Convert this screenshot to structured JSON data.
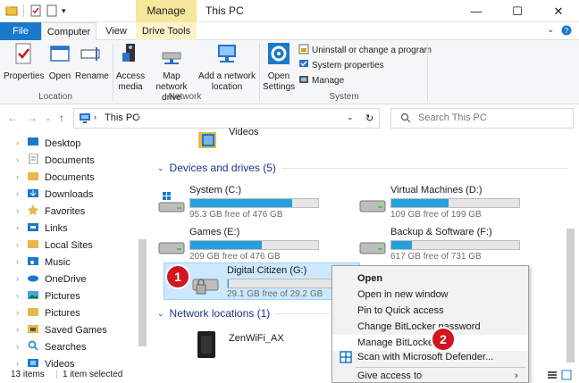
{
  "window": {
    "title": "This PC",
    "context_tab": "Manage",
    "minimize": "—",
    "maximize": "☐",
    "close": "✕"
  },
  "ribbon_tabs": {
    "file": "File",
    "computer": "Computer",
    "view": "View",
    "drive_tools": "Drive Tools"
  },
  "ribbon": {
    "location": {
      "label": "Location",
      "properties": "Properties",
      "open": "Open",
      "rename": "Rename"
    },
    "network": {
      "label": "Network",
      "access_media": "Access media",
      "map_network_drive": "Map network drive",
      "add_network_location": "Add a network location"
    },
    "system": {
      "label": "System",
      "open_settings": "Open Settings",
      "uninstall": "Uninstall or change a program",
      "system_properties": "System properties",
      "manage": "Manage"
    }
  },
  "address": {
    "path": "This PC",
    "search_placeholder": "Search This PC"
  },
  "nav_items": [
    {
      "label": "Desktop",
      "icon": "desktop-icon"
    },
    {
      "label": "Documents",
      "icon": "documents-icon"
    },
    {
      "label": "Documents",
      "icon": "folder-icon"
    },
    {
      "label": "Downloads",
      "icon": "downloads-icon"
    },
    {
      "label": "Favorites",
      "icon": "favorites-icon"
    },
    {
      "label": "Links",
      "icon": "links-icon"
    },
    {
      "label": "Local Sites",
      "icon": "folder-icon"
    },
    {
      "label": "Music",
      "icon": "music-icon"
    },
    {
      "label": "OneDrive",
      "icon": "onedrive-icon"
    },
    {
      "label": "Pictures",
      "icon": "pictures-icon"
    },
    {
      "label": "Pictures",
      "icon": "folder-icon"
    },
    {
      "label": "Saved Games",
      "icon": "saved-games-icon"
    },
    {
      "label": "Searches",
      "icon": "searches-icon"
    },
    {
      "label": "Videos",
      "icon": "videos-icon"
    }
  ],
  "content": {
    "videos_label": "Videos",
    "devices_header": "Devices and drives (5)",
    "network_header": "Network locations (1)",
    "drives": [
      {
        "name": "System (C:)",
        "free": "95.3 GB free of 476 GB",
        "used_fraction": 0.8
      },
      {
        "name": "Virtual Machines (D:)",
        "free": "109 GB free of 199 GB",
        "used_fraction": 0.45
      },
      {
        "name": "Games (E:)",
        "free": "209 GB free of 476 GB",
        "used_fraction": 0.56
      },
      {
        "name": "Backup & Software (F:)",
        "free": "617 GB free of 731 GB",
        "used_fraction": 0.16
      },
      {
        "name": "Digital Citizen (G:)",
        "free": "29.1 GB free of 29.2 GB",
        "used_fraction": 0.01
      }
    ],
    "network_location": "ZenWiFi_AX"
  },
  "context_menu": {
    "open": "Open",
    "open_new_window": "Open in new window",
    "pin_quick_access": "Pin to Quick access",
    "change_bitlocker_password": "Change BitLocker password",
    "manage_bitlocker": "Manage BitLocker",
    "scan_defender": "Scan with Microsoft Defender...",
    "give_access": "Give access to"
  },
  "status": {
    "items": "13 items",
    "selected": "1 item selected"
  },
  "badges": {
    "one": "1",
    "two": "2"
  },
  "colors": {
    "accent": "#1979ca",
    "bar_fill": "#26a0da",
    "selection": "#cce8ff",
    "badge": "#d0161f",
    "group_header": "#1e3287"
  }
}
